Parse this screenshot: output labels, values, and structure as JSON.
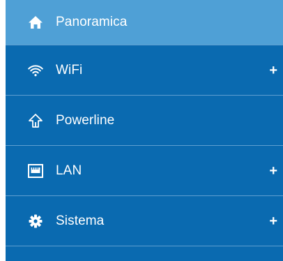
{
  "nav": {
    "items": [
      {
        "label": "Panoramica",
        "icon": "home-icon",
        "active": true,
        "expandable": false
      },
      {
        "label": "WiFi",
        "icon": "wifi-icon",
        "active": false,
        "expandable": true,
        "expand_symbol": "+"
      },
      {
        "label": "Powerline",
        "icon": "powerline-icon",
        "active": false,
        "expandable": false
      },
      {
        "label": "LAN",
        "icon": "lan-port-icon",
        "active": false,
        "expandable": true,
        "expand_symbol": "+"
      },
      {
        "label": "Sistema",
        "icon": "gear-icon",
        "active": false,
        "expandable": true,
        "expand_symbol": "+"
      }
    ]
  },
  "colors": {
    "sidebar_bg": "#0a6ab0",
    "active_bg": "#4fa0d6",
    "divider": "#5e9fd0",
    "text": "#ffffff"
  }
}
